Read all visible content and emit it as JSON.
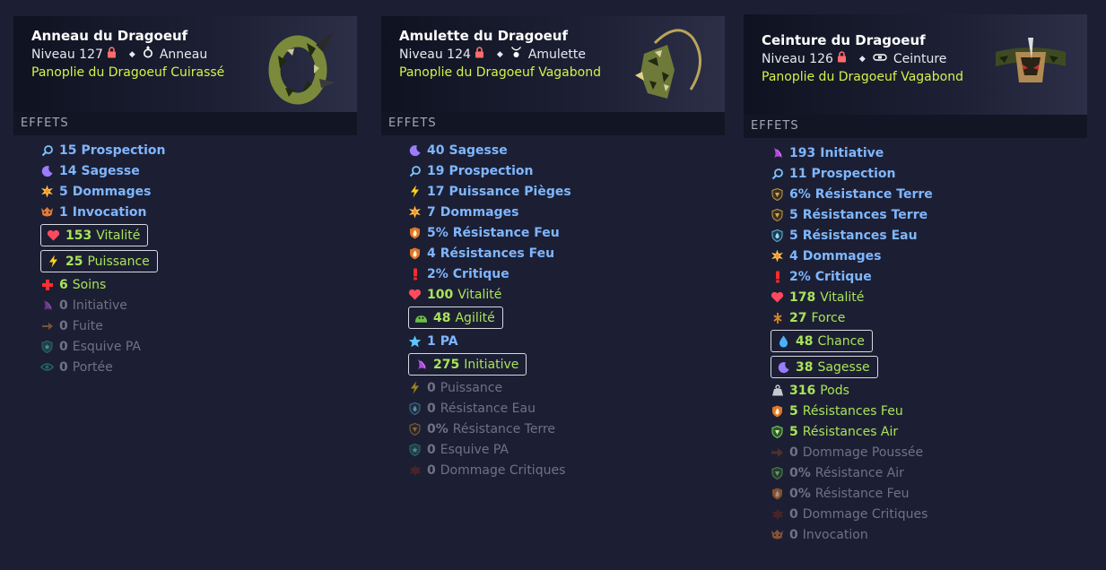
{
  "colors": {
    "bg": "#1c1f33",
    "set": "#d6f14a",
    "blue": "#7fb6ff",
    "green": "#a9e35a",
    "grey": "#6f7284"
  },
  "cards": [
    {
      "title": "Anneau du Dragoeuf",
      "level": "Niveau 127",
      "type": "Anneau",
      "type_icon": "ring-icon",
      "set": "Panoplie du Dragoeuf Cuirassé",
      "effects_label": "EFFETS",
      "effects": [
        {
          "value": "15",
          "label": "Prospection",
          "style": "blue",
          "icon": "magnifier-icon"
        },
        {
          "value": "14",
          "label": "Sagesse",
          "style": "blue",
          "icon": "moon-icon"
        },
        {
          "value": "5",
          "label": "Dommages",
          "style": "blue",
          "icon": "burst-icon"
        },
        {
          "value": "1",
          "label": "Invocation",
          "style": "blue",
          "icon": "summon-icon"
        },
        {
          "value": "153",
          "label": "Vitalité",
          "style": "green",
          "icon": "heart-icon",
          "boxed": true
        },
        {
          "value": "25",
          "label": "Puissance",
          "style": "green",
          "icon": "bolt-icon",
          "boxed": true
        },
        {
          "value": "6",
          "label": "Soins",
          "style": "green",
          "icon": "cross-icon"
        },
        {
          "value": "0",
          "label": "Initiative",
          "style": "grey",
          "icon": "initiative-icon"
        },
        {
          "value": "0",
          "label": "Fuite",
          "style": "grey",
          "icon": "escape-icon"
        },
        {
          "value": "0",
          "label": "Esquive PA",
          "style": "grey",
          "icon": "shield-icon"
        },
        {
          "value": "0",
          "label": "Portée",
          "style": "grey",
          "icon": "eye-icon"
        }
      ]
    },
    {
      "title": "Amulette du Dragoeuf",
      "level": "Niveau 124",
      "type": "Amulette",
      "type_icon": "amulet-icon",
      "set": "Panoplie du Dragoeuf Vagabond",
      "effects_label": "EFFETS",
      "effects": [
        {
          "value": "40",
          "label": "Sagesse",
          "style": "blue",
          "icon": "moon-icon"
        },
        {
          "value": "19",
          "label": "Prospection",
          "style": "blue",
          "icon": "magnifier-icon"
        },
        {
          "value": "17",
          "label": "Puissance Pièges",
          "style": "blue",
          "icon": "bolt-icon"
        },
        {
          "value": "7",
          "label": "Dommages",
          "style": "blue",
          "icon": "burst-icon"
        },
        {
          "value": "5%",
          "label": "Résistance Feu",
          "style": "blue",
          "icon": "fire-shield-icon"
        },
        {
          "value": "4",
          "label": "Résistances Feu",
          "style": "blue",
          "icon": "fire-shield-icon"
        },
        {
          "value": "2%",
          "label": "Critique",
          "style": "blue",
          "icon": "exclamation-icon"
        },
        {
          "value": "100",
          "label": "Vitalité",
          "style": "green",
          "icon": "heart-icon"
        },
        {
          "value": "48",
          "label": "Agilité",
          "style": "green",
          "icon": "agility-icon",
          "boxed": true
        },
        {
          "value": "1",
          "label": "PA",
          "style": "blue",
          "icon": "star-icon"
        },
        {
          "value": "275",
          "label": "Initiative",
          "style": "green",
          "icon": "initiative-icon",
          "boxed": true
        },
        {
          "value": "0",
          "label": "Puissance",
          "style": "grey",
          "icon": "bolt-icon"
        },
        {
          "value": "0",
          "label": "Résistance Eau",
          "style": "grey",
          "icon": "water-shield-icon"
        },
        {
          "value": "0%",
          "label": "Résistance Terre",
          "style": "grey",
          "icon": "earth-shield-icon"
        },
        {
          "value": "0",
          "label": "Esquive PA",
          "style": "grey",
          "icon": "shield-icon"
        },
        {
          "value": "0",
          "label": "Dommage Critiques",
          "style": "grey",
          "icon": "crit-damage-icon"
        }
      ]
    },
    {
      "title": "Ceinture du Dragoeuf",
      "level": "Niveau 126",
      "type": "Ceinture",
      "type_icon": "belt-icon",
      "set": "Panoplie du Dragoeuf Vagabond",
      "effects_label": "EFFETS",
      "effects": [
        {
          "value": "193",
          "label": "Initiative",
          "style": "blue",
          "icon": "initiative-icon"
        },
        {
          "value": "11",
          "label": "Prospection",
          "style": "blue",
          "icon": "magnifier-icon"
        },
        {
          "value": "6%",
          "label": "Résistance Terre",
          "style": "blue",
          "icon": "earth-shield-icon"
        },
        {
          "value": "5",
          "label": "Résistances Terre",
          "style": "blue",
          "icon": "earth-shield-icon"
        },
        {
          "value": "5",
          "label": "Résistances Eau",
          "style": "blue",
          "icon": "water-shield-icon"
        },
        {
          "value": "4",
          "label": "Dommages",
          "style": "blue",
          "icon": "burst-icon"
        },
        {
          "value": "2%",
          "label": "Critique",
          "style": "blue",
          "icon": "exclamation-icon"
        },
        {
          "value": "178",
          "label": "Vitalité",
          "style": "green",
          "icon": "heart-icon"
        },
        {
          "value": "27",
          "label": "Force",
          "style": "green",
          "icon": "strength-icon"
        },
        {
          "value": "48",
          "label": "Chance",
          "style": "green",
          "icon": "water-drop-icon",
          "boxed": true
        },
        {
          "value": "38",
          "label": "Sagesse",
          "style": "green",
          "icon": "moon-icon",
          "boxed": true
        },
        {
          "value": "316",
          "label": "Pods",
          "style": "green",
          "icon": "weight-icon"
        },
        {
          "value": "5",
          "label": "Résistances Feu",
          "style": "green",
          "icon": "fire-shield-icon"
        },
        {
          "value": "5",
          "label": "Résistances Air",
          "style": "green",
          "icon": "air-shield-icon"
        },
        {
          "value": "0",
          "label": "Dommage Poussée",
          "style": "grey",
          "icon": "push-icon"
        },
        {
          "value": "0%",
          "label": "Résistance Air",
          "style": "grey",
          "icon": "air-shield-icon"
        },
        {
          "value": "0%",
          "label": "Résistance Feu",
          "style": "grey",
          "icon": "fire-shield-icon"
        },
        {
          "value": "0",
          "label": "Dommage Critiques",
          "style": "grey",
          "icon": "crit-damage-icon"
        },
        {
          "value": "0",
          "label": "Invocation",
          "style": "grey",
          "icon": "summon-icon"
        }
      ]
    }
  ]
}
